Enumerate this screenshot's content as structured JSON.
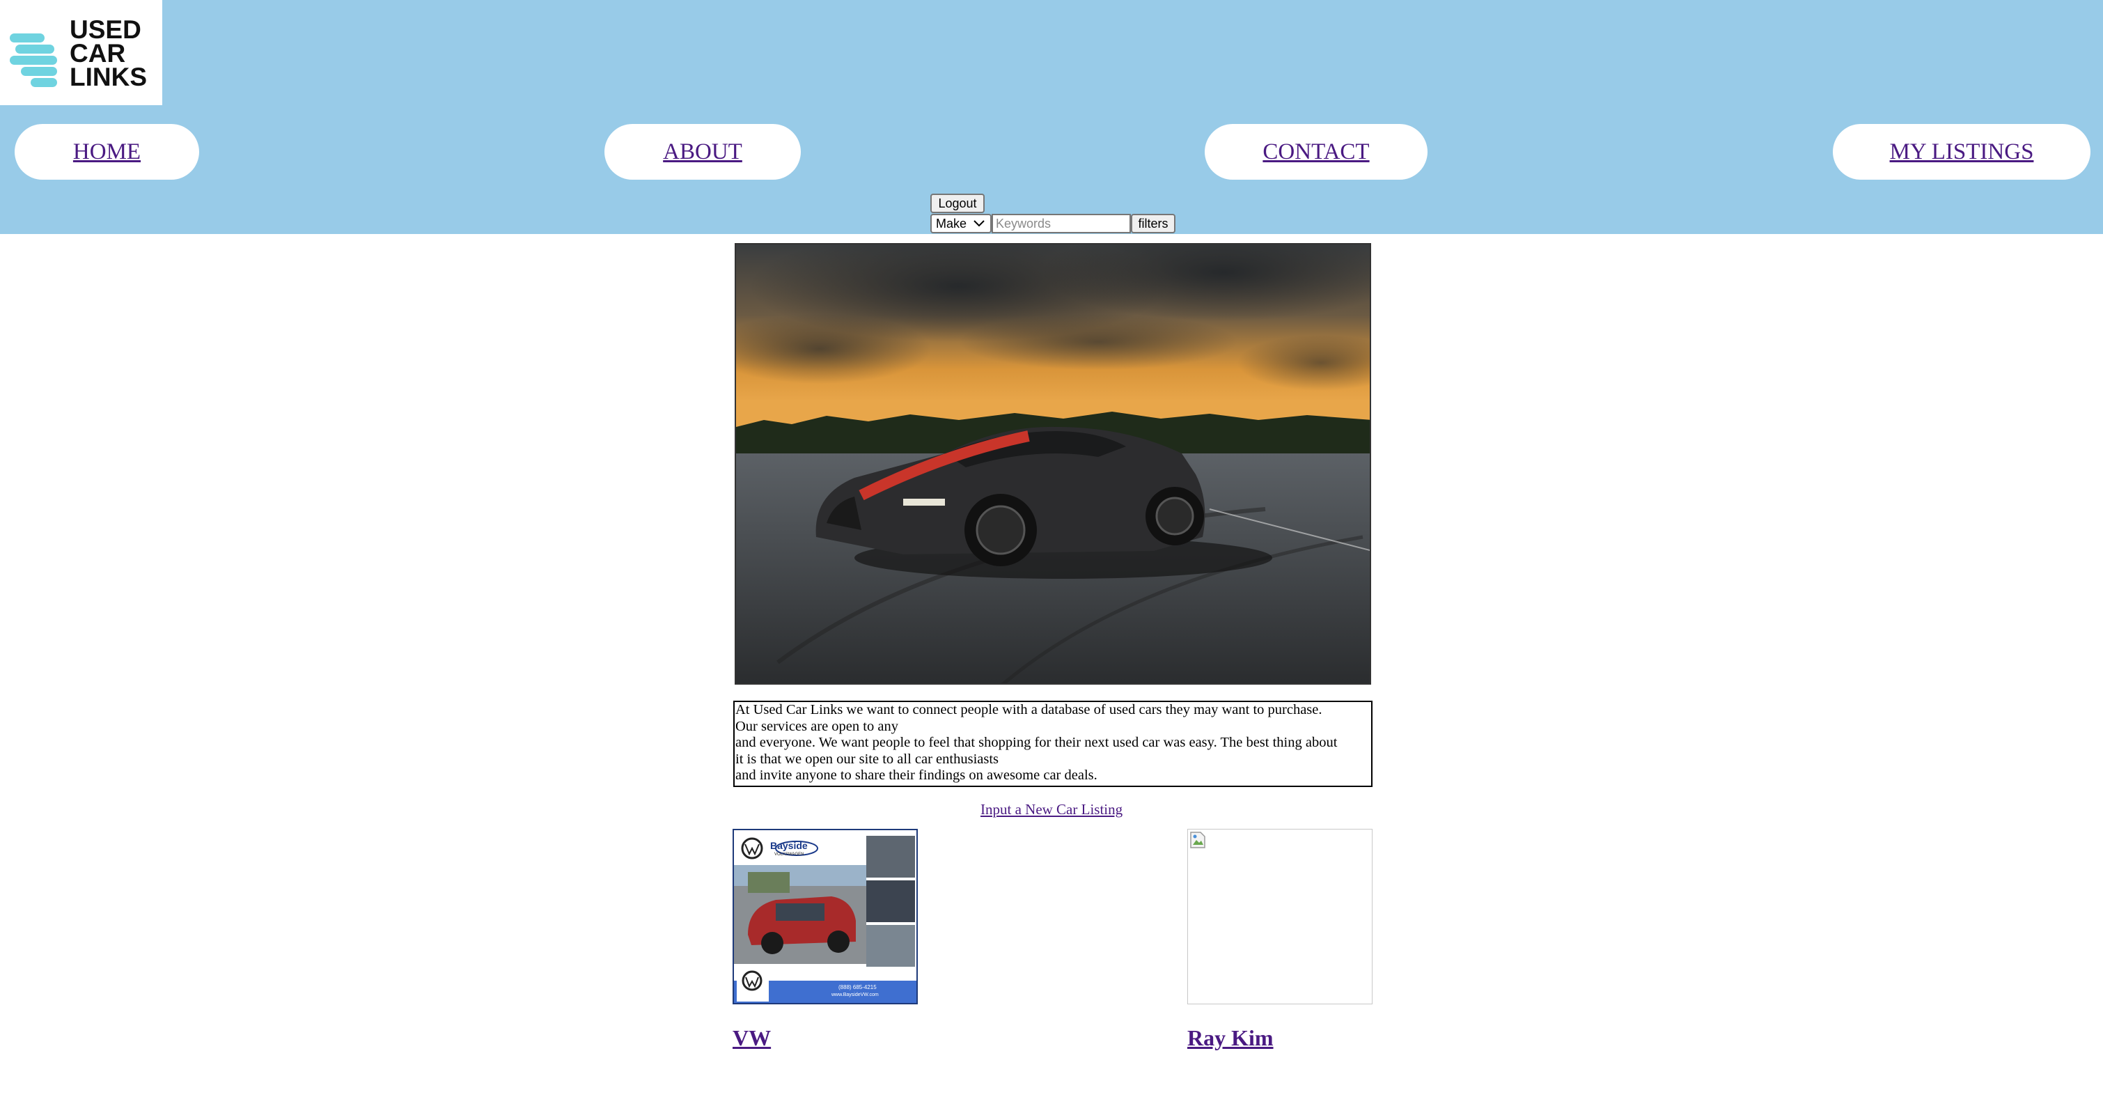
{
  "logo": {
    "line1": "USED",
    "line2": "CAR",
    "line3": "LINKS"
  },
  "nav": {
    "home": "HOME",
    "about": "ABOUT",
    "contact": "CONTACT",
    "my_listings": "MY LISTINGS"
  },
  "controls": {
    "logout_label": "Logout",
    "make_selected": "Make",
    "keywords_placeholder": "Keywords",
    "filters_label": "filters"
  },
  "about": {
    "lines": [
      "At Used Car Links we want to connect people with a database of used cars they may want to purchase.",
      "Our services are open to any",
      "and everyone. We want people to feel that shopping for their next used car was easy. The best thing about",
      "it is that we open our site to all car enthusiasts",
      "and invite anyone to share their findings on awesome car deals."
    ]
  },
  "new_listing_link": "Input a New Car Listing",
  "listings": [
    {
      "title": "VW",
      "ad_brand": "Bayside",
      "ad_sub": "VOLKSWAGEN",
      "ad_phone": "(888) 685-4215",
      "ad_web": "www.BaysideVW.com"
    },
    {
      "title": "Ray Kim"
    }
  ],
  "colors": {
    "header_bg": "#98cbe8",
    "logo_accent": "#6fd3e0",
    "link": "#4a1a82"
  }
}
